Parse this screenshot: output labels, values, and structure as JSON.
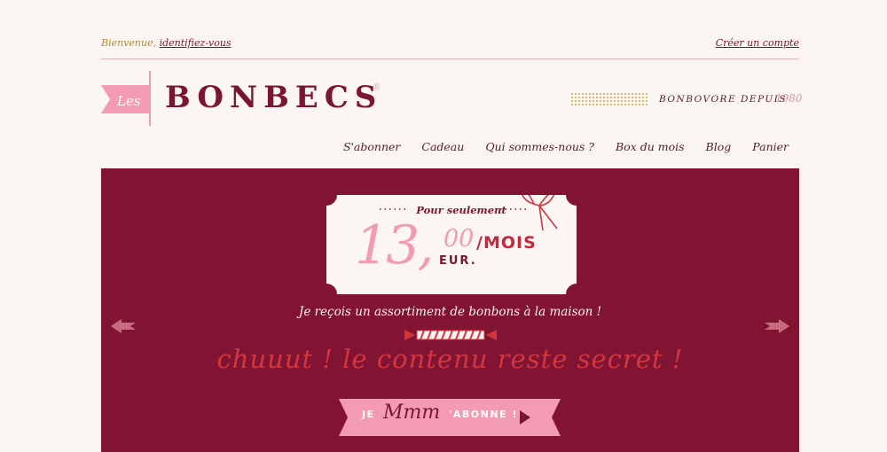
{
  "header": {
    "welcome_prefix": "Bienvenue, ",
    "login_link": "identifiez-vous",
    "create_account": "Créer un compte"
  },
  "logo": {
    "flag_text": "Les",
    "brand": "BONBECS",
    "registered": "®"
  },
  "tagline": {
    "text": "BONBOVORE DEPUIS",
    "year": "1980"
  },
  "nav": {
    "items": [
      "S'abonner",
      "Cadeau",
      "Qui sommes-nous ?",
      "Box du mois",
      "Blog",
      "Panier"
    ]
  },
  "banner": {
    "pour_seulement": "Pour seulement",
    "price_whole": "13,",
    "price_cents": "00",
    "currency": "EUR.",
    "per": "/MOIS",
    "description": "Je reçois un assortiment de bonbons à la maison !",
    "secret": "chuuut ! le contenu reste secret !",
    "cta_je": "JE",
    "cta_mmm": "Mmm",
    "cta_abonne": "'ABONNE !"
  },
  "colors": {
    "burgundy": "#811432",
    "pink": "#f29bb2",
    "red": "#d4363f",
    "background": "#fbf6f1"
  }
}
